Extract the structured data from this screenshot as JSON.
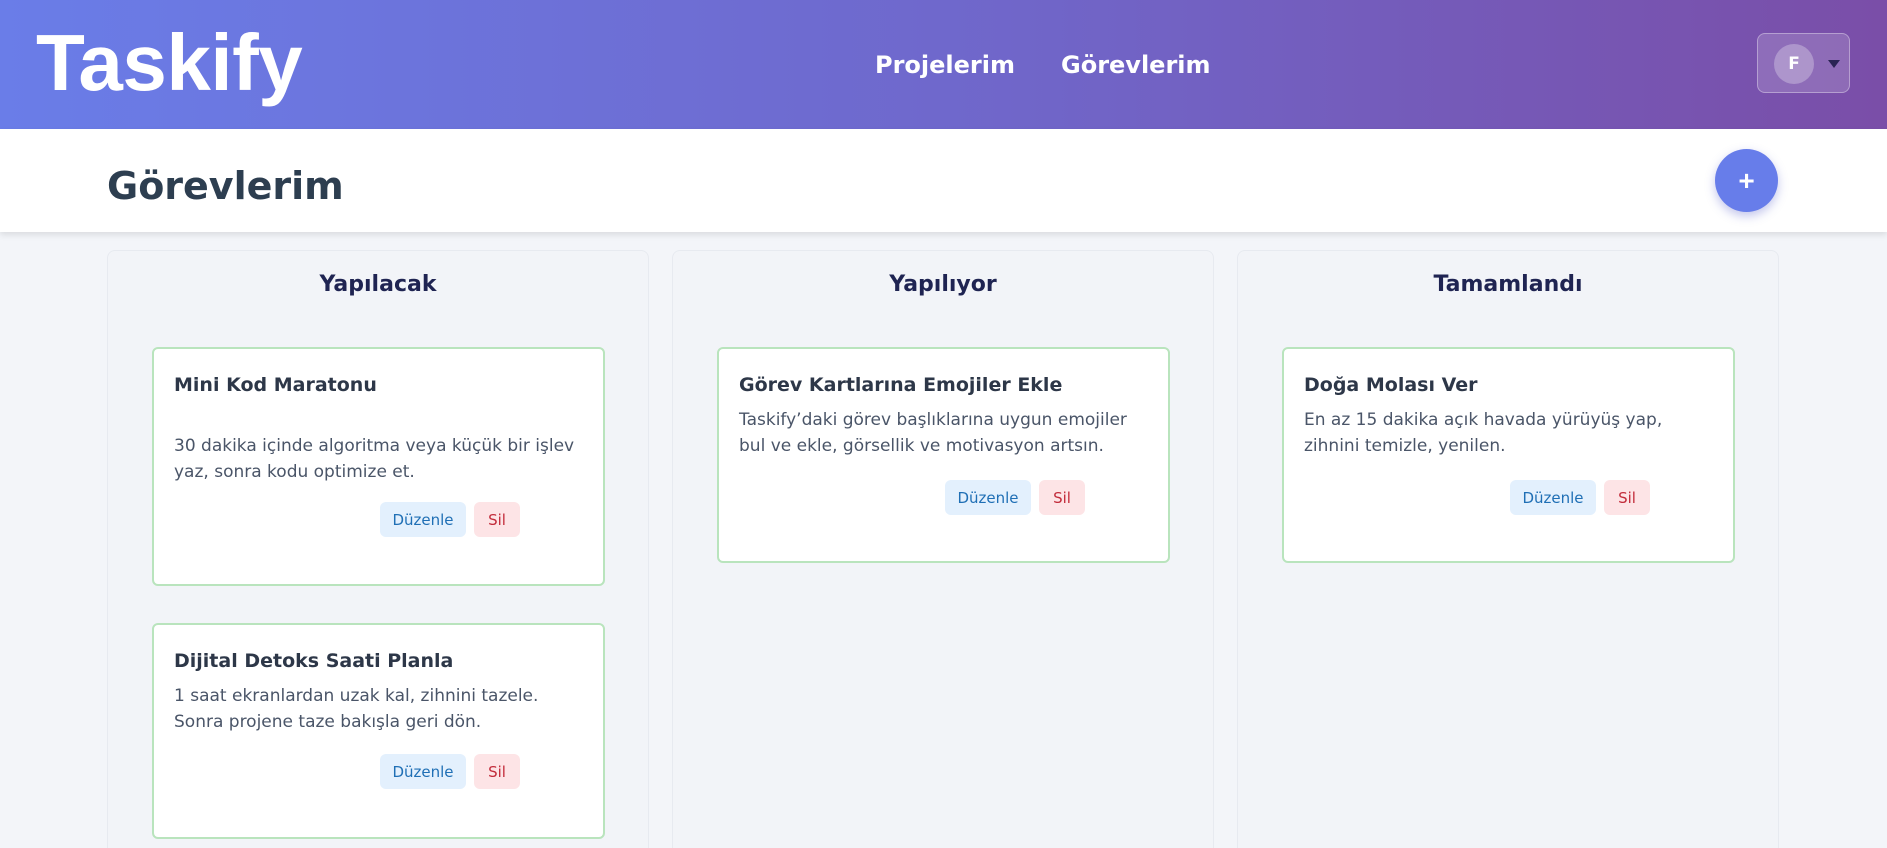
{
  "header": {
    "logo": "Taskify",
    "nav": [
      "Projelerim",
      "Görevlerim"
    ],
    "user_initial": "F"
  },
  "page": {
    "title": "Görevlerim",
    "add_label": "+"
  },
  "columns": [
    {
      "title": "Yapılacak",
      "cards": [
        {
          "title": "Mini Kod Maratonu",
          "description": "30 dakika içinde algoritma veya küçük bir işlev yaz, sonra kodu optimize et.",
          "edit_label": "Düzenle",
          "delete_label": "Sil"
        },
        {
          "title": "Dijital Detoks Saati Planla",
          "description": "1 saat ekranlardan uzak kal, zihnini tazele. Sonra projene taze bakışla geri dön.",
          "edit_label": "Düzenle",
          "delete_label": "Sil"
        }
      ]
    },
    {
      "title": "Yapılıyor",
      "cards": [
        {
          "title": "Görev Kartlarına Emojiler Ekle",
          "description": "Taskify’daki görev başlıklarına uygun emojiler bul ve ekle, görsellik ve motivasyon artsın.",
          "edit_label": "Düzenle",
          "delete_label": "Sil"
        }
      ]
    },
    {
      "title": "Tamamlandı",
      "cards": [
        {
          "title": "Doğa Molası Ver",
          "description": "En az 15 dakika açık havada yürüyüş yap, zihnini temizle, yenilen.",
          "edit_label": "Düzenle",
          "delete_label": "Sil"
        }
      ]
    }
  ]
}
